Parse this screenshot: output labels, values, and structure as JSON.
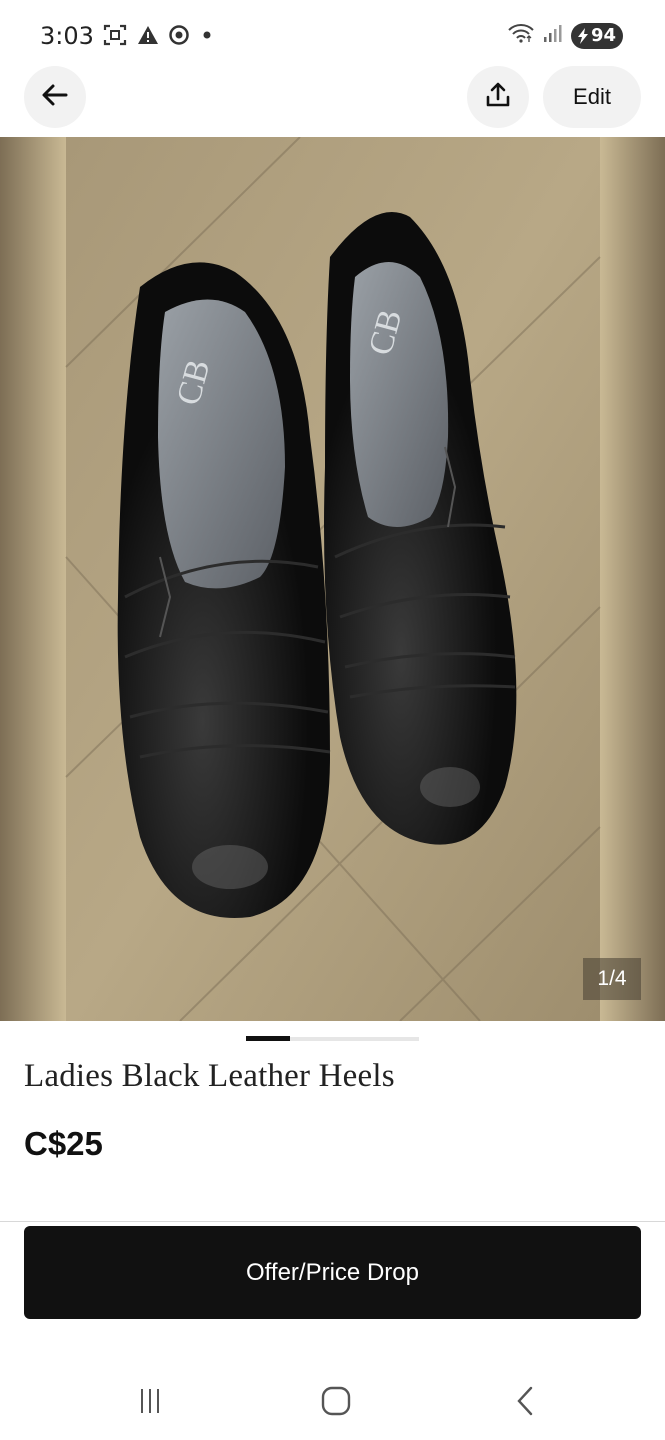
{
  "status_bar": {
    "time": "3:03",
    "battery": "94",
    "icons": [
      "screenshot-icon",
      "alert-icon",
      "chrome-icon",
      "dot-icon",
      "wifi-icon",
      "signal-icon",
      "battery-icon"
    ]
  },
  "header": {
    "back_icon": "arrow-left-icon",
    "share_icon": "share-upload-icon",
    "edit_label": "Edit"
  },
  "listing": {
    "image_counter": "1/4",
    "title": "Ladies Black Leather Heels",
    "price": "C$25",
    "carousel": {
      "current": 1,
      "total": 4
    }
  },
  "action": {
    "offer_label": "Offer/Price Drop"
  },
  "navbar": {
    "icons": [
      "recent-apps-icon",
      "home-icon",
      "back-nav-icon"
    ]
  },
  "colors": {
    "cta_background": "#111111",
    "photo_background": "#9a8a6c",
    "button_background": "#f2f2f2"
  }
}
